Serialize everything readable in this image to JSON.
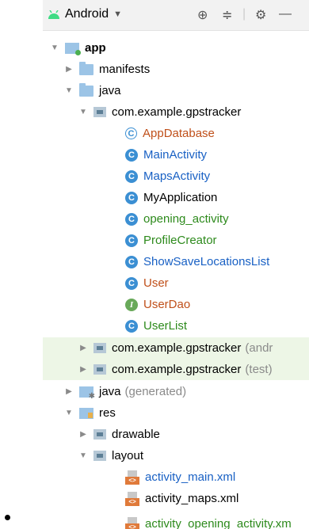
{
  "toolbar": {
    "view_mode": "Android"
  },
  "tree": {
    "app": "app",
    "manifests": "manifests",
    "java": "java",
    "package_main": "com.example.gpstracker",
    "classes": [
      {
        "label": "AppDatabase"
      },
      {
        "label": "MainActivity"
      },
      {
        "label": "MapsActivity"
      },
      {
        "label": "MyApplication"
      },
      {
        "label": "opening_activity"
      },
      {
        "label": "ProfileCreator"
      },
      {
        "label": "ShowSaveLocationsList"
      },
      {
        "label": "User"
      },
      {
        "label": "UserDao"
      },
      {
        "label": "UserList"
      }
    ],
    "package_android_test": "com.example.gpstracker",
    "package_android_test_suffix": "(andr",
    "package_test": "com.example.gpstracker",
    "package_test_suffix": "(test)",
    "java_generated": "java",
    "java_generated_suffix": "(generated)",
    "res": "res",
    "drawable": "drawable",
    "layout": "layout",
    "layout_files": [
      {
        "label": "activity_main.xml"
      },
      {
        "label": "activity_maps.xml"
      },
      {
        "label": "activity_opening_activity.xm"
      }
    ]
  },
  "colors": {
    "highlight": "#edf6e6",
    "class_icon": "#3b8fd3",
    "interface_icon": "#69a95a"
  }
}
